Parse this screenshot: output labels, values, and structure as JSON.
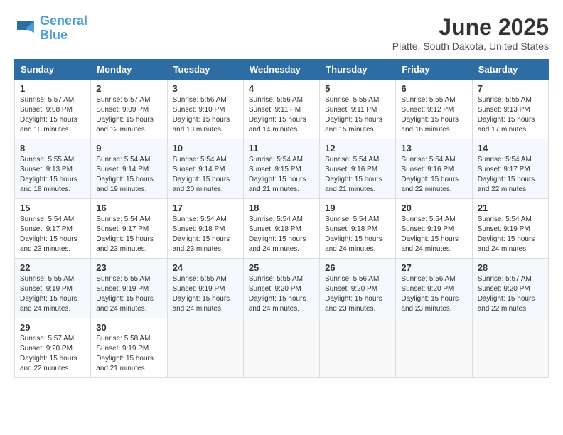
{
  "logo": {
    "line1": "General",
    "line2": "Blue"
  },
  "title": "June 2025",
  "location": "Platte, South Dakota, United States",
  "weekdays": [
    "Sunday",
    "Monday",
    "Tuesday",
    "Wednesday",
    "Thursday",
    "Friday",
    "Saturday"
  ],
  "weeks": [
    [
      {
        "day": "1",
        "sunrise": "5:57 AM",
        "sunset": "9:08 PM",
        "daylight": "15 hours and 10 minutes."
      },
      {
        "day": "2",
        "sunrise": "5:57 AM",
        "sunset": "9:09 PM",
        "daylight": "15 hours and 12 minutes."
      },
      {
        "day": "3",
        "sunrise": "5:56 AM",
        "sunset": "9:10 PM",
        "daylight": "15 hours and 13 minutes."
      },
      {
        "day": "4",
        "sunrise": "5:56 AM",
        "sunset": "9:11 PM",
        "daylight": "15 hours and 14 minutes."
      },
      {
        "day": "5",
        "sunrise": "5:55 AM",
        "sunset": "9:11 PM",
        "daylight": "15 hours and 15 minutes."
      },
      {
        "day": "6",
        "sunrise": "5:55 AM",
        "sunset": "9:12 PM",
        "daylight": "15 hours and 16 minutes."
      },
      {
        "day": "7",
        "sunrise": "5:55 AM",
        "sunset": "9:13 PM",
        "daylight": "15 hours and 17 minutes."
      }
    ],
    [
      {
        "day": "8",
        "sunrise": "5:55 AM",
        "sunset": "9:13 PM",
        "daylight": "15 hours and 18 minutes."
      },
      {
        "day": "9",
        "sunrise": "5:54 AM",
        "sunset": "9:14 PM",
        "daylight": "15 hours and 19 minutes."
      },
      {
        "day": "10",
        "sunrise": "5:54 AM",
        "sunset": "9:14 PM",
        "daylight": "15 hours and 20 minutes."
      },
      {
        "day": "11",
        "sunrise": "5:54 AM",
        "sunset": "9:15 PM",
        "daylight": "15 hours and 21 minutes."
      },
      {
        "day": "12",
        "sunrise": "5:54 AM",
        "sunset": "9:16 PM",
        "daylight": "15 hours and 21 minutes."
      },
      {
        "day": "13",
        "sunrise": "5:54 AM",
        "sunset": "9:16 PM",
        "daylight": "15 hours and 22 minutes."
      },
      {
        "day": "14",
        "sunrise": "5:54 AM",
        "sunset": "9:17 PM",
        "daylight": "15 hours and 22 minutes."
      }
    ],
    [
      {
        "day": "15",
        "sunrise": "5:54 AM",
        "sunset": "9:17 PM",
        "daylight": "15 hours and 23 minutes."
      },
      {
        "day": "16",
        "sunrise": "5:54 AM",
        "sunset": "9:17 PM",
        "daylight": "15 hours and 23 minutes."
      },
      {
        "day": "17",
        "sunrise": "5:54 AM",
        "sunset": "9:18 PM",
        "daylight": "15 hours and 23 minutes."
      },
      {
        "day": "18",
        "sunrise": "5:54 AM",
        "sunset": "9:18 PM",
        "daylight": "15 hours and 24 minutes."
      },
      {
        "day": "19",
        "sunrise": "5:54 AM",
        "sunset": "9:18 PM",
        "daylight": "15 hours and 24 minutes."
      },
      {
        "day": "20",
        "sunrise": "5:54 AM",
        "sunset": "9:19 PM",
        "daylight": "15 hours and 24 minutes."
      },
      {
        "day": "21",
        "sunrise": "5:54 AM",
        "sunset": "9:19 PM",
        "daylight": "15 hours and 24 minutes."
      }
    ],
    [
      {
        "day": "22",
        "sunrise": "5:55 AM",
        "sunset": "9:19 PM",
        "daylight": "15 hours and 24 minutes."
      },
      {
        "day": "23",
        "sunrise": "5:55 AM",
        "sunset": "9:19 PM",
        "daylight": "15 hours and 24 minutes."
      },
      {
        "day": "24",
        "sunrise": "5:55 AM",
        "sunset": "9:19 PM",
        "daylight": "15 hours and 24 minutes."
      },
      {
        "day": "25",
        "sunrise": "5:55 AM",
        "sunset": "9:20 PM",
        "daylight": "15 hours and 24 minutes."
      },
      {
        "day": "26",
        "sunrise": "5:56 AM",
        "sunset": "9:20 PM",
        "daylight": "15 hours and 23 minutes."
      },
      {
        "day": "27",
        "sunrise": "5:56 AM",
        "sunset": "9:20 PM",
        "daylight": "15 hours and 23 minutes."
      },
      {
        "day": "28",
        "sunrise": "5:57 AM",
        "sunset": "9:20 PM",
        "daylight": "15 hours and 22 minutes."
      }
    ],
    [
      {
        "day": "29",
        "sunrise": "5:57 AM",
        "sunset": "9:20 PM",
        "daylight": "15 hours and 22 minutes."
      },
      {
        "day": "30",
        "sunrise": "5:58 AM",
        "sunset": "9:19 PM",
        "daylight": "15 hours and 21 minutes."
      },
      null,
      null,
      null,
      null,
      null
    ]
  ]
}
